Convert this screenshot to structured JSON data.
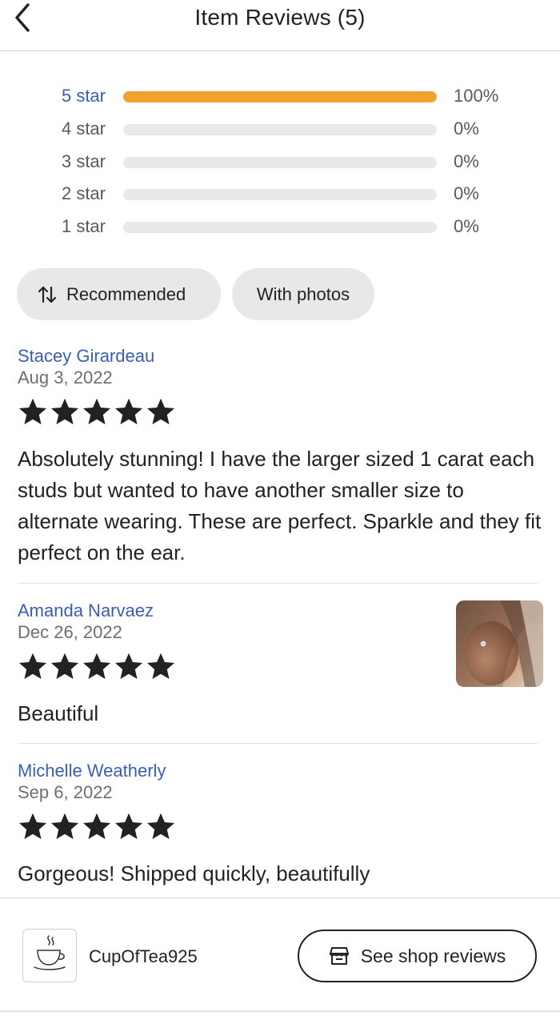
{
  "header": {
    "title": "Item Reviews (5)",
    "back_icon": "chevron-left-icon"
  },
  "rating_breakdown": [
    {
      "label": "5 star",
      "percent_text": "100%",
      "fill": 1.0
    },
    {
      "label": "4 star",
      "percent_text": "0%",
      "fill": 0.0
    },
    {
      "label": "3 star",
      "percent_text": "0%",
      "fill": 0.0
    },
    {
      "label": "2 star",
      "percent_text": "0%",
      "fill": 0.0
    },
    {
      "label": "1 star",
      "percent_text": "0%",
      "fill": 0.0
    }
  ],
  "filters": {
    "sort_label": "Recommended",
    "sort_icon": "sort-arrows-icon",
    "photos_label": "With photos"
  },
  "reviews": [
    {
      "reviewer": "Stacey Girardeau",
      "date": "Aug 3, 2022",
      "rating": 5,
      "text": "Absolutely stunning!  I have the larger sized 1 carat each studs but wanted to have another smaller size to alternate wearing.  These are perfect.  Sparkle and they fit perfect on the ear."
    },
    {
      "reviewer": "Amanda Narvaez",
      "date": "Dec 26, 2022",
      "rating": 5,
      "text": "Beautiful",
      "has_photo": true
    },
    {
      "reviewer": "Michelle Weatherly",
      "date": "Sep 6, 2022",
      "rating": 5,
      "text": "Gorgeous! Shipped quickly, beautifully"
    }
  ],
  "shop": {
    "name": "CupOfTea925",
    "logo_icon": "teacup-logo-icon",
    "reviews_button_label": "See shop reviews",
    "reviews_button_icon": "store-icon"
  },
  "colors": {
    "accent_link": "#3a5fb0",
    "rating_bar_fill": "#f1a12e",
    "rating_bar_track": "#e9e9e9",
    "pill_bg": "#e8e8e8",
    "star": "#222222"
  }
}
